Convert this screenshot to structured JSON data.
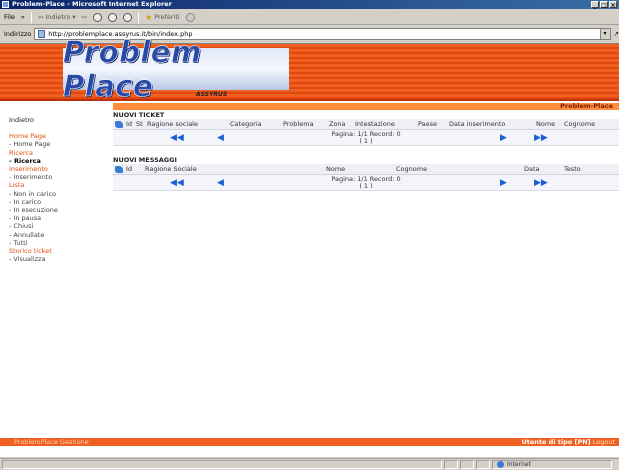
{
  "window": {
    "title": "Problem-Place - Microsoft Internet Explorer",
    "controls": [
      "_",
      "□",
      "×"
    ]
  },
  "toolbar": {
    "file": "File",
    "more": "»",
    "back": "Indietro",
    "favorites": "Preferiti"
  },
  "address": {
    "label": "Indirizzo",
    "url": "http://problemplace.assyrus.it/bin/index.php"
  },
  "banner": {
    "logo": "Problem Place",
    "subbrand": "ASSYRUS"
  },
  "sidebar": {
    "back": "Indietro",
    "groups": [
      {
        "title": "Home Page",
        "items": [
          {
            "label": "- Home Page",
            "bold": false
          }
        ]
      },
      {
        "title": "Ricerca",
        "items": [
          {
            "label": "- Ricerca",
            "bold": true
          }
        ]
      },
      {
        "title": "Inserimento",
        "items": [
          {
            "label": "- Inserimento",
            "bold": false
          }
        ]
      },
      {
        "title": "Lista",
        "items": [
          {
            "label": "- Non in carico",
            "bold": false
          },
          {
            "label": "- In carico",
            "bold": false
          },
          {
            "label": "- In esecuzione",
            "bold": false
          },
          {
            "label": "- In pausa",
            "bold": false
          },
          {
            "label": "- Chiusi",
            "bold": false
          },
          {
            "label": "- Annullate",
            "bold": false
          },
          {
            "label": "- Tutti",
            "bold": false
          }
        ]
      },
      {
        "title": "Storico ticket",
        "items": [
          {
            "label": "- Visualizza",
            "bold": false
          }
        ]
      }
    ]
  },
  "main": {
    "brand": "Problem-Place",
    "tickets": {
      "title": "NUOVI TICKET",
      "columns": [
        "Id",
        "St",
        "Ragione sociale",
        "Categoria",
        "Problema",
        "Zona",
        "Intestazione",
        "Paese",
        "Data inserimento",
        "Nome",
        "Cognome"
      ],
      "pagination": {
        "page": "Pagina: 1/1",
        "records": "Record: 0",
        "current": "( 1 )"
      }
    },
    "messages": {
      "title": "NUOVI MESSAGGI",
      "columns": [
        "Id",
        "Ragione Sociale",
        "Nome",
        "Cognome",
        "Data",
        "Testo"
      ],
      "pagination": {
        "page": "Pagina: 1/1",
        "records": "Record: 0",
        "current": "( 1 )"
      }
    },
    "nav": {
      "first": "◀◀",
      "prev": "◀",
      "next": "▶",
      "last": "▶▶"
    }
  },
  "footer": {
    "left": "ProblemPlace Gestione",
    "user": "Utente di tipo [PN]",
    "logout": "Logout"
  },
  "statusbar": {
    "zone": "Internet"
  },
  "colors": {
    "accent": "#f06020",
    "header_bar": "#ff8c3c",
    "nav_arrow": "#1b5fd6",
    "menu_section": "#e05010"
  }
}
